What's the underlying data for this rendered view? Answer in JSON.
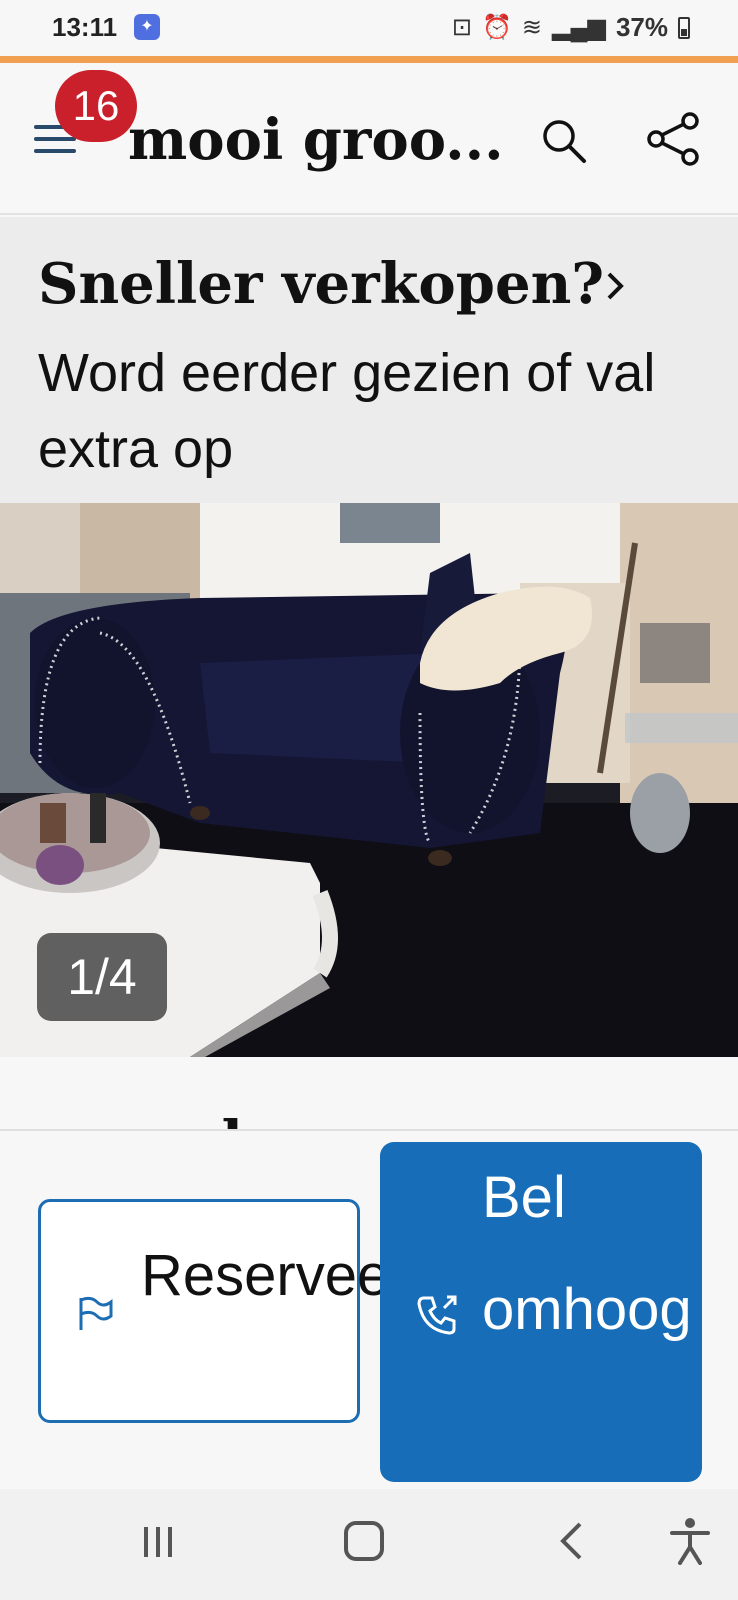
{
  "status_bar": {
    "time": "13:11",
    "battery": "37%"
  },
  "header": {
    "notification_count": "16",
    "title": "mooi groo..."
  },
  "promo": {
    "title": "Sneller verkopen?",
    "subtitle": "Word eerder gezien of val extra op"
  },
  "gallery": {
    "counter": "1/4"
  },
  "partial_text": "el",
  "actions": {
    "reserve_label": "Reserveer",
    "call_label": "Bel omhoog"
  },
  "colors": {
    "accent": "#f0a050",
    "badge": "#c9202b",
    "primary": "#176db7"
  },
  "icons": {
    "menu": "menu-icon",
    "search": "search-icon",
    "share": "share-icon",
    "chevron": "chevron-right-icon",
    "flag": "flag-icon",
    "phone": "phone-outgoing-icon",
    "nav_recents": "recents-icon",
    "nav_home": "home-icon",
    "nav_back": "back-icon",
    "accessibility": "accessibility-icon"
  }
}
